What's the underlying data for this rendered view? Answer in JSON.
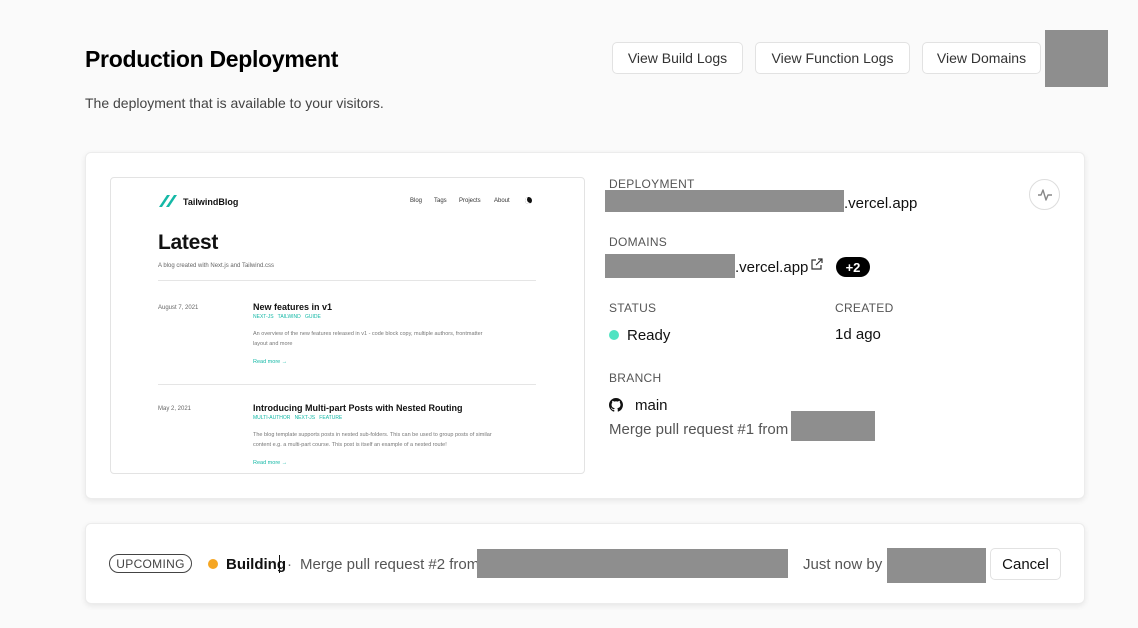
{
  "header": {
    "title": "Production Deployment",
    "subtitle": "The deployment that is available to your visitors.",
    "buttons": {
      "build_logs": "View Build Logs",
      "function_logs": "View Function Logs",
      "domains": "View Domains"
    }
  },
  "preview": {
    "logo_text": "TailwindBlog",
    "nav": [
      "Blog",
      "Tags",
      "Projects",
      "About"
    ],
    "heading": "Latest",
    "tagline": "A blog created with Next.js and Tailwind.css",
    "posts": [
      {
        "date": "August 7, 2021",
        "title": "New features in v1",
        "tags": "NEXT-JS   TAILWIND   GUIDE",
        "excerpt_line1": "An overview of the new features released in v1 - code block copy, multiple authors, frontmatter",
        "excerpt_line2": "layout and more",
        "read_more": "Read more →"
      },
      {
        "date": "May 2, 2021",
        "title": "Introducing Multi-part Posts with Nested Routing",
        "tags": "MULTI-AUTHOR   NEXT-JS   FEATURE",
        "excerpt_line1": "The blog template supports posts in nested sub-folders. This can be used to group posts of similar",
        "excerpt_line2": "content e.g. a multi-part course. This post is itself an example of a nested route!",
        "read_more": "Read more →"
      }
    ]
  },
  "deployment": {
    "label": "DEPLOYMENT",
    "url_suffix": ".vercel.app"
  },
  "domains": {
    "label": "DOMAINS",
    "url_suffix": ".vercel.app",
    "extra_badge": "+2"
  },
  "status": {
    "label": "STATUS",
    "value": "Ready",
    "color": "#50e3c2"
  },
  "created": {
    "label": "CREATED",
    "value": "1d ago"
  },
  "branch": {
    "label": "BRANCH",
    "name": "main",
    "commit_message": "Merge pull request #1 from "
  },
  "upcoming": {
    "badge": "UPCOMING",
    "state": "Building",
    "state_color": "#f5a623",
    "separator": "·",
    "commit_message": "Merge pull request #2 from",
    "time_text": "Just now by",
    "cancel_label": "Cancel"
  },
  "colors": {
    "accent_teal": "#14b8a6",
    "badge_bg": "#000000"
  }
}
